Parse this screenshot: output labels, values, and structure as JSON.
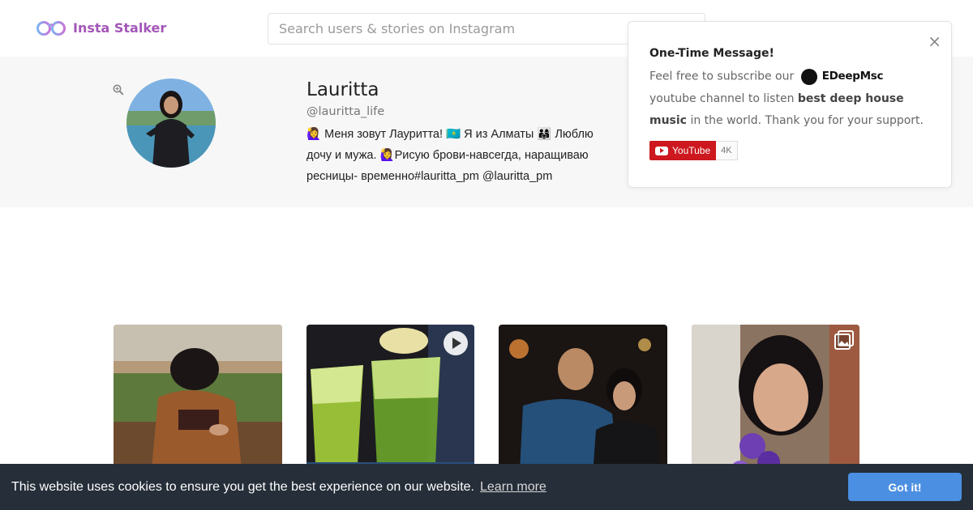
{
  "header": {
    "app_name": "Insta Stalker",
    "search_placeholder": "Search users & stories on Instagram"
  },
  "profile": {
    "name": "Lauritta",
    "handle": "@lauritta_life",
    "bio": "🙋‍♀ Меня зовут Лауритта! 🇰🇿 Я из Алматы 👨‍👩‍👧 Люблю дочу и мужа. 🙋‍♀Рисую брови-навсегда, наращиваю ресницы- временно#lauritta_pm @lauritta_pm"
  },
  "popup": {
    "title": "One-Time Message!",
    "text_before": "Feel free to subscribe our",
    "channel_name": "EDeepMsc",
    "text_after": "youtube channel to listen",
    "bold_text": "best deep house music",
    "text_end": "in the world. Thank you for your support.",
    "close_label": "×",
    "youtube_label": "YouTube",
    "youtube_count": "4K"
  },
  "posts": [
    {
      "kind": "photo"
    },
    {
      "kind": "video"
    },
    {
      "kind": "photo"
    },
    {
      "kind": "gallery"
    }
  ],
  "cookie": {
    "message": "This website uses cookies to ensure you get the best experience on our website.",
    "link": "Learn more",
    "button": "Got it!"
  },
  "colors": {
    "brand": "#a356b8",
    "cookie_bg": "#252e39",
    "cookie_button": "#4b8fe2",
    "youtube_red": "#cc181e"
  }
}
